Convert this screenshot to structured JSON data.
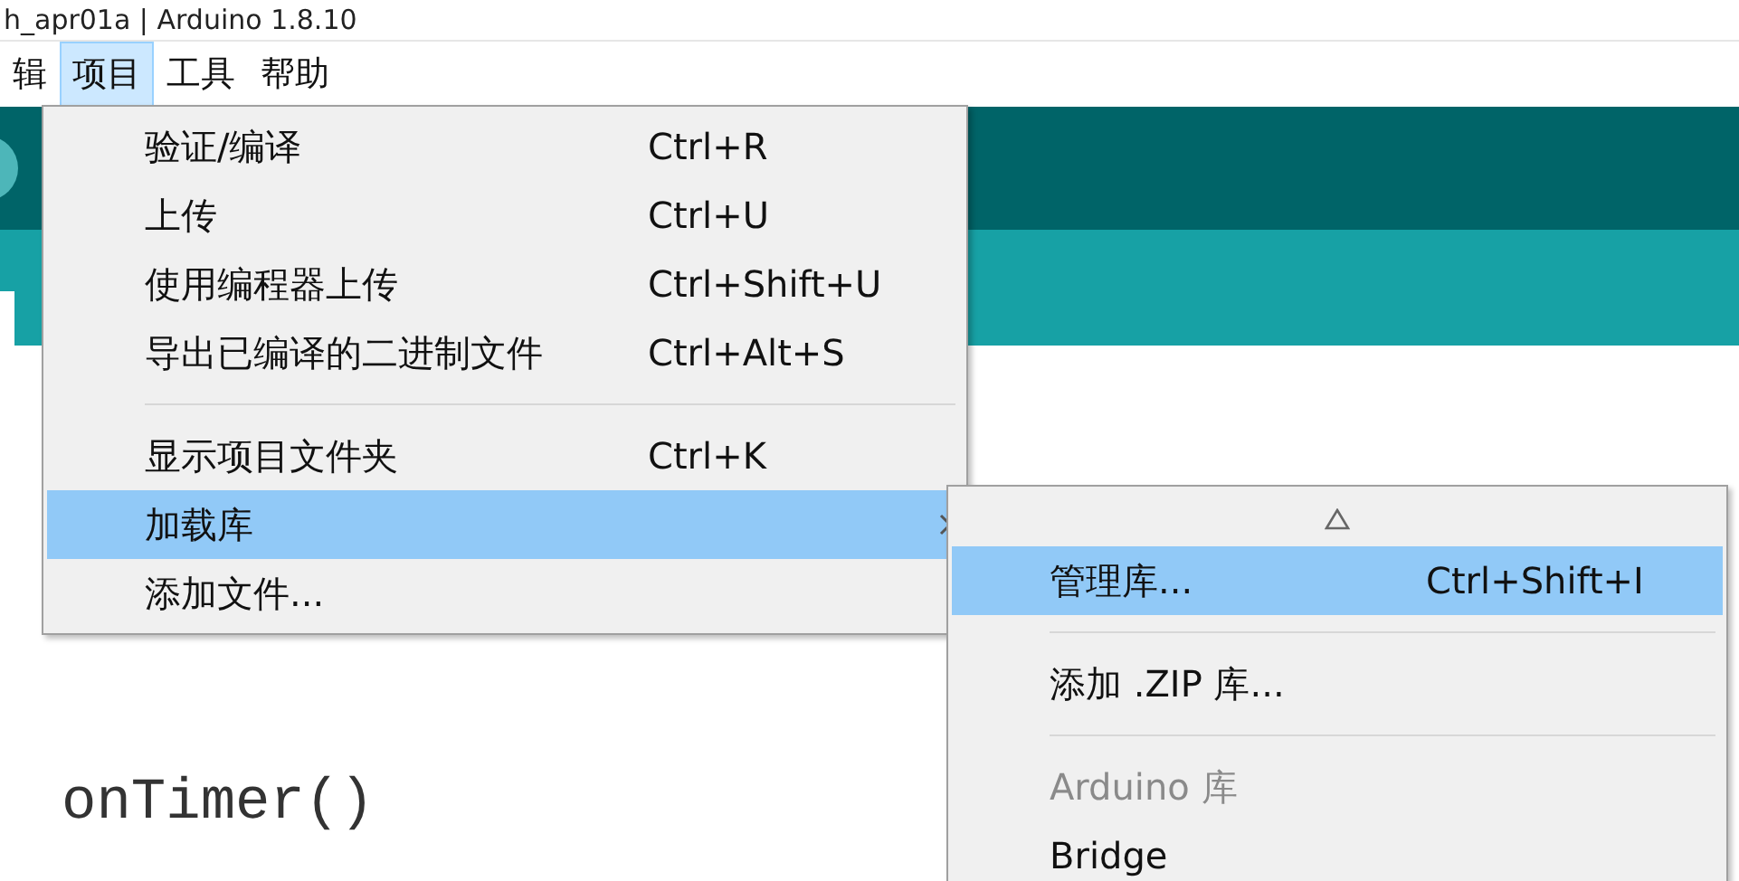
{
  "window": {
    "title": "h_apr01a | Arduino 1.8.10"
  },
  "menubar": [
    {
      "label": "辑",
      "selected": false
    },
    {
      "label": "项目",
      "selected": true
    },
    {
      "label": "工具",
      "selected": false
    },
    {
      "label": "帮助",
      "selected": false
    }
  ],
  "editor": {
    "code_lines": [
      {
        "text": "onTimer()"
      }
    ]
  },
  "menu": [
    {
      "kind": "item",
      "label": "验证/编译",
      "shortcut": "Ctrl+R",
      "selected": false,
      "submenu": false
    },
    {
      "kind": "item",
      "label": "上传",
      "shortcut": "Ctrl+U",
      "selected": false,
      "submenu": false
    },
    {
      "kind": "item",
      "label": "使用编程器上传",
      "shortcut": "Ctrl+Shift+U",
      "selected": false,
      "submenu": false
    },
    {
      "kind": "item",
      "label": "导出已编译的二进制文件",
      "shortcut": "Ctrl+Alt+S",
      "selected": false,
      "submenu": false
    },
    {
      "kind": "separator"
    },
    {
      "kind": "item",
      "label": "显示项目文件夹",
      "shortcut": "Ctrl+K",
      "selected": false,
      "submenu": false
    },
    {
      "kind": "item",
      "label": "加载库",
      "selected": true,
      "submenu": true
    },
    {
      "kind": "item",
      "label": "添加文件...",
      "selected": false,
      "submenu": false
    }
  ],
  "submenu": [
    {
      "kind": "item",
      "label": "管理库...",
      "shortcut": "Ctrl+Shift+I",
      "selected": true
    },
    {
      "kind": "separator"
    },
    {
      "kind": "item",
      "label": "添加 .ZIP 库...",
      "selected": false
    },
    {
      "kind": "separator"
    },
    {
      "kind": "header",
      "label": "Arduino 库"
    },
    {
      "kind": "item",
      "label": "Bridge",
      "selected": false
    }
  ]
}
